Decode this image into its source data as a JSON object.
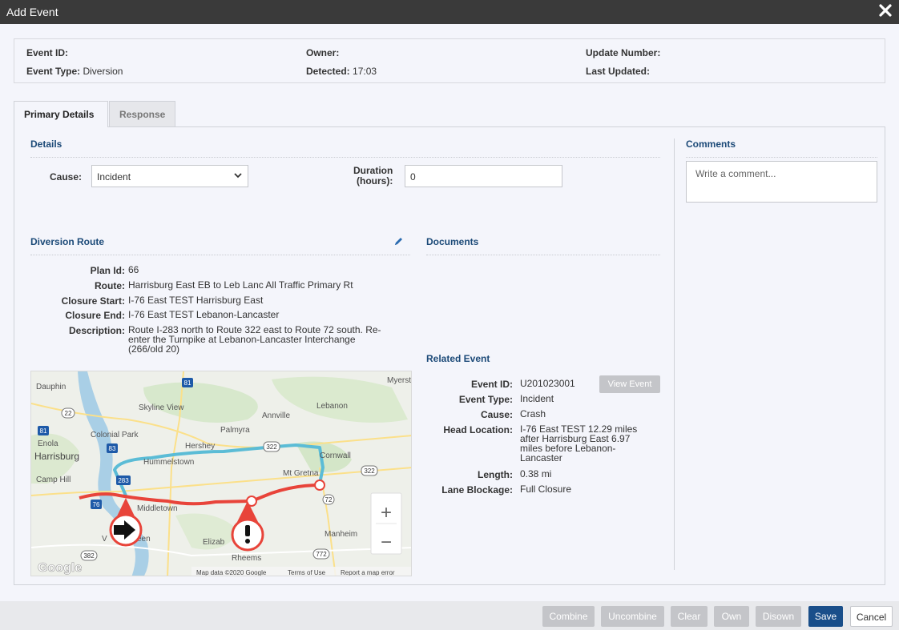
{
  "window": {
    "title": "Add Event",
    "close_icon": "close-icon"
  },
  "header": {
    "event_id_label": "Event ID:",
    "event_id_value": "",
    "owner_label": "Owner:",
    "owner_value": "",
    "update_number_label": "Update Number:",
    "update_number_value": "",
    "event_type_label": "Event Type:",
    "event_type_value": "Diversion",
    "detected_label": "Detected:",
    "detected_value": "17:03",
    "last_updated_label": "Last Updated:",
    "last_updated_value": ""
  },
  "tabs": [
    {
      "label": "Primary Details",
      "active": true
    },
    {
      "label": "Response",
      "active": false
    }
  ],
  "details": {
    "title": "Details",
    "cause_label": "Cause:",
    "cause_value": "Incident",
    "duration_label_1": "Duration",
    "duration_label_2": "(hours):",
    "duration_value": "0"
  },
  "diversion": {
    "title": "Diversion Route",
    "edit_icon": "pencil-icon",
    "plan_id_label": "Plan Id:",
    "plan_id_value": "66",
    "route_label": "Route:",
    "route_value": "Harrisburg East EB to Leb Lanc All Traffic Primary Rt",
    "closure_start_label": "Closure Start:",
    "closure_start_value": "I-76 East TEST Harrisburg East",
    "closure_end_label": "Closure End:",
    "closure_end_value": "I-76 East TEST Lebanon-Lancaster",
    "description_label": "Description:",
    "description_line1": "Route I-283 north to Route 322 east  to Route 72 south.  Re-",
    "description_line2": "enter the Turnpike at Lebanon-Lancaster Interchange",
    "description_line3": "(266/old 20)"
  },
  "map": {
    "places": {
      "dauphin": "Dauphin",
      "myerstown": "Myersto",
      "skyline_view": "Skyline View",
      "lebanon": "Lebanon",
      "annville": "Annville",
      "colonial_park": "Colonial Park",
      "palmyra": "Palmyra",
      "enola": "Enola",
      "hershey": "Hershey",
      "harrisburg": "Harrisburg",
      "hummelstown": "Hummelstown",
      "cornwall": "Cornwall",
      "mt_gretna": "Mt Gretna",
      "camp_hill": "Camp Hill",
      "middletown": "Middletown",
      "manheim": "Manheim",
      "elizabethtown": "Elizab",
      "rheems": "Rheems",
      "marietta_partial": "V",
      "marietta_partial2": "een"
    },
    "shields": {
      "s81": "81",
      "s22": "22",
      "s81b": "81",
      "s83": "83",
      "s322a": "322",
      "s322b": "322",
      "s283": "283",
      "s76": "76",
      "s72": "72",
      "s382": "382",
      "s772": "772"
    },
    "attribution": "Map data ©2020 Google",
    "terms": "Terms of Use",
    "report": "Report a map error",
    "logo": "Google",
    "zoom_in": "+",
    "zoom_out": "−"
  },
  "documents": {
    "title": "Documents"
  },
  "related": {
    "title": "Related Event",
    "event_id_label": "Event ID:",
    "event_id_value": "U201023001",
    "view_button": "View Event",
    "event_type_label": "Event Type:",
    "event_type_value": "Incident",
    "cause_label": "Cause:",
    "cause_value": "Crash",
    "head_location_label": "Head Location:",
    "head_location_line1": "I-76 East TEST 12.29 miles",
    "head_location_line2": "after Harrisburg East 6.97",
    "head_location_line3": "miles before Lebanon-",
    "head_location_line4": "Lancaster",
    "length_label": "Length:",
    "length_value": "0.38 mi",
    "lane_blockage_label": "Lane Blockage:",
    "lane_blockage_value": "Full Closure"
  },
  "comments": {
    "title": "Comments",
    "placeholder": "Write a comment..."
  },
  "footer": {
    "combine": "Combine",
    "uncombine": "Uncombine",
    "clear": "Clear",
    "own": "Own",
    "disown": "Disown",
    "save": "Save",
    "cancel": "Cancel"
  },
  "colors": {
    "accent": "#1a4f8a",
    "section_title": "#1c4a78",
    "route_primary": "#e8443a",
    "route_diversion": "#5bbcd6"
  }
}
